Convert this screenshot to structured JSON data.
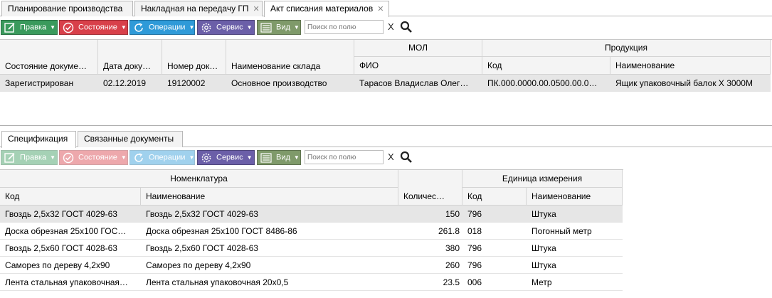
{
  "top_tabs": [
    {
      "label": "Планирование производства",
      "closable": false
    },
    {
      "label": "Накладная на передачу ГП",
      "closable": true
    },
    {
      "label": "Акт списания материалов",
      "closable": true,
      "active": true
    }
  ],
  "close_glyph": "✕",
  "toolbar": {
    "edit_label": "Правка",
    "state_label": "Состояние",
    "operations_label": "Операции",
    "service_label": "Сервис",
    "view_label": "Вид",
    "search_placeholder": "Поиск по полю",
    "clear_label": "X",
    "icons": {
      "edit": "edit-icon",
      "state": "check-circle-icon",
      "operations": "refresh-icon",
      "service": "gear-icon",
      "view": "list-icon",
      "search": "search-icon"
    },
    "colors": {
      "edit": "#3a9a5c",
      "state": "#d8404a",
      "operations": "#2f9ad8",
      "service": "#6b5fa8",
      "view": "#7f9a6a"
    }
  },
  "main_grid": {
    "group_headers": {
      "mol": "МОЛ",
      "product": "Продукция"
    },
    "columns": {
      "state": "Состояние докуме…",
      "date": "Дата доку…",
      "number": "Номер док…",
      "warehouse": "Наименование склада",
      "fio": "ФИО",
      "code": "Код",
      "name": "Наименование"
    },
    "rows": [
      {
        "state": "Зарегистрирован",
        "date": "02.12.2019",
        "number": "19120002",
        "warehouse": "Основное производство",
        "fio": "Тарасов Владислав Олег…",
        "code": "ПК.000.0000.00.0500.00.0…",
        "name": "Ящик упаковочный балок Х 3000М"
      }
    ]
  },
  "bottom_tabs": [
    {
      "label": "Спецификация",
      "active": true
    },
    {
      "label": "Связанные документы",
      "active": false
    }
  ],
  "bottom_toolbar": {
    "edit_label": "Правка",
    "state_label": "Состояние",
    "operations_label": "Операции",
    "service_label": "Сервис",
    "view_label": "Вид",
    "search_placeholder": "Поиск по полю",
    "clear_label": "X",
    "disabled": [
      "edit",
      "state",
      "operations"
    ]
  },
  "spec_grid": {
    "group_headers": {
      "nomenclature": "Номенклатура",
      "unit": "Единица измерения"
    },
    "columns": {
      "code": "Код",
      "name": "Наименование",
      "qty": "Количес…",
      "unit_code": "Код",
      "unit_name": "Наименование"
    },
    "rows": [
      {
        "code": "Гвоздь 2,5х32 ГОСТ 4029-63",
        "name": "Гвоздь 2,5х32 ГОСТ 4029-63",
        "qty": "150",
        "unit_code": "796",
        "unit_name": "Штука"
      },
      {
        "code": "Доска обрезная 25х100 ГОС…",
        "name": "Доска обрезная 25х100 ГОСТ 8486-86",
        "qty": "261.8",
        "unit_code": "018",
        "unit_name": "Погонный метр"
      },
      {
        "code": "Гвоздь 2,5х60 ГОСТ 4028-63",
        "name": "Гвоздь 2,5х60 ГОСТ 4028-63",
        "qty": "380",
        "unit_code": "796",
        "unit_name": "Штука"
      },
      {
        "code": "Саморез по дереву 4,2х90",
        "name": "Саморез по дереву 4,2х90",
        "qty": "260",
        "unit_code": "796",
        "unit_name": "Штука"
      },
      {
        "code": "Лента стальная упаковочная…",
        "name": "Лента стальная упаковочная 20х0,5",
        "qty": "23.5",
        "unit_code": "006",
        "unit_name": "Метр"
      }
    ]
  }
}
